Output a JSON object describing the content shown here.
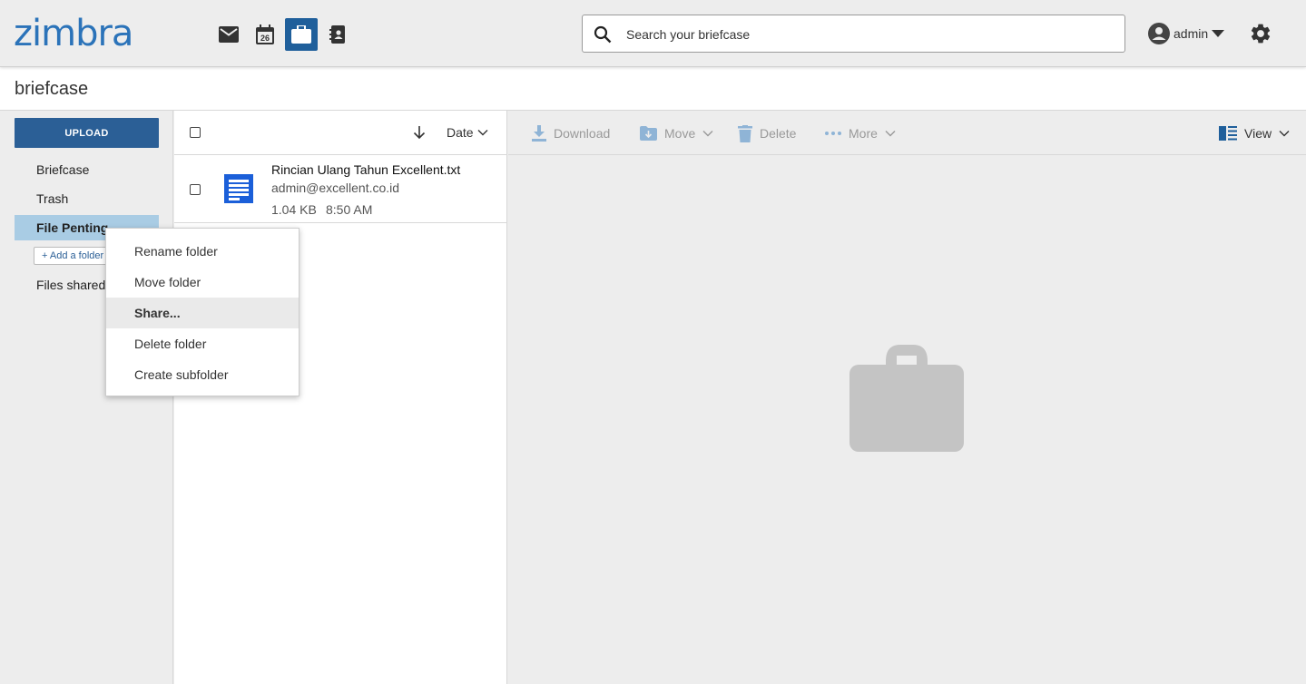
{
  "header": {
    "logo": "zimbra",
    "apps": [
      {
        "name": "mail-icon",
        "active": false
      },
      {
        "name": "calendar-icon",
        "day": "26",
        "active": false
      },
      {
        "name": "briefcase-icon",
        "active": true
      },
      {
        "name": "contacts-icon",
        "active": false
      }
    ],
    "search_placeholder": "Search your briefcase",
    "username": "admin"
  },
  "page": {
    "title": "briefcase"
  },
  "sidebar": {
    "upload_label": "UPLOAD",
    "folders": [
      {
        "label": "Briefcase"
      },
      {
        "label": "Trash"
      },
      {
        "label": "File Penting"
      },
      {
        "label": "Files shared with me"
      }
    ],
    "add_folder_label": "+ Add a folder"
  },
  "list": {
    "sort_label": "Date",
    "files": [
      {
        "name": "Rincian Ulang Tahun Excellent.txt",
        "owner": "admin@excellent.co.id",
        "size": "1.04 KB",
        "time": "8:50 AM"
      }
    ]
  },
  "toolbar": {
    "download": "Download",
    "move": "Move",
    "delete": "Delete",
    "more": "More",
    "view": "View"
  },
  "context_menu": {
    "items": [
      {
        "label": "Rename folder"
      },
      {
        "label": "Move folder"
      },
      {
        "label": "Share..."
      },
      {
        "label": "Delete folder"
      },
      {
        "label": "Create subfolder"
      }
    ]
  },
  "colors": {
    "brand": "#2b73b9",
    "primary_button": "#2b5f96",
    "selected_folder": "#a9cce4",
    "file_icon": "#1b5fd9"
  }
}
